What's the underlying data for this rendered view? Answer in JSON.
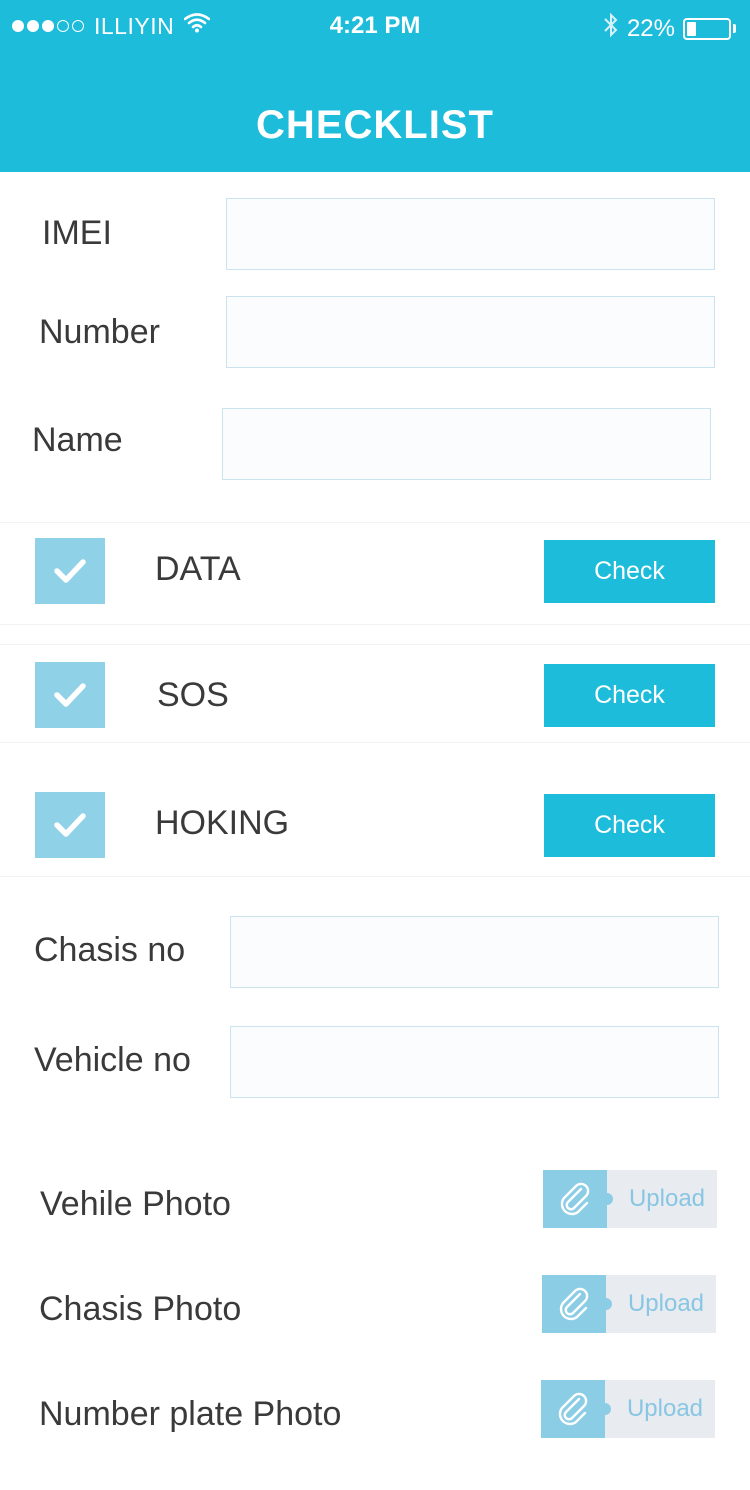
{
  "status_bar": {
    "carrier": "ILLIYIN",
    "time": "4:21 PM",
    "battery": "22%",
    "battery_level": 0.22,
    "signal_icon": "signal-dots-icon",
    "wifi_icon": "wifi-icon",
    "bluetooth_icon": "bluetooth-icon"
  },
  "header": {
    "title": "CHECKLIST",
    "color": "#1dbcdb"
  },
  "fields": {
    "imei": {
      "label": "IMEI",
      "value": ""
    },
    "number": {
      "label": "Number",
      "value": ""
    },
    "name": {
      "label": "Name",
      "value": ""
    },
    "chasis_no": {
      "label": "Chasis no",
      "value": ""
    },
    "vehicle_no": {
      "label": "Vehicle no",
      "value": ""
    }
  },
  "checks": [
    {
      "label": "DATA",
      "checked": true,
      "button": "Check"
    },
    {
      "label": "SOS",
      "checked": true,
      "button": "Check"
    },
    {
      "label": "HOKING",
      "checked": true,
      "button": "Check"
    }
  ],
  "uploads": [
    {
      "label": "Vehile Photo",
      "button": "Upload",
      "icon": "paperclip-icon"
    },
    {
      "label": "Chasis Photo",
      "button": "Upload",
      "icon": "paperclip-icon"
    },
    {
      "label": "Number plate Photo",
      "button": "Upload",
      "icon": "paperclip-icon"
    }
  ]
}
